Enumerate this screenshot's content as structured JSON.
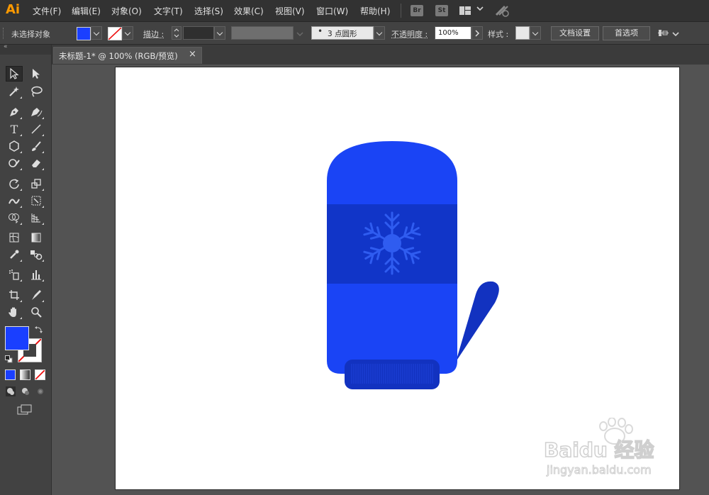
{
  "app": {
    "logo": "Ai"
  },
  "menu": [
    "文件(F)",
    "编辑(E)",
    "对象(O)",
    "文字(T)",
    "选择(S)",
    "效果(C)",
    "视图(V)",
    "窗口(W)",
    "帮助(H)"
  ],
  "app_buttons": {
    "bridge": "Br",
    "stock": "St"
  },
  "control": {
    "selection_status": "未选择对象",
    "stroke_label": "描边 :",
    "brush_value": "3 点圆形",
    "opacity_label": "不透明度 :",
    "opacity_value": "100%",
    "style_label": "样式 :",
    "doc_setup_button": "文档设置",
    "preferences_button": "首选项"
  },
  "document": {
    "tab_title": "未标题-1* @ 100% (RGB/预览)",
    "close_glyph": "×"
  },
  "colors": {
    "fill": "#1a3fff",
    "mitten_main": "#1a44f5",
    "mitten_band": "#1135c8",
    "cuff": "#1232c0",
    "snowflake": "#2f5cf0",
    "stroke": "none"
  },
  "tools": [
    "selection-tool",
    "direct-selection-tool",
    "magic-wand-tool",
    "lasso-tool",
    "pen-tool",
    "curvature-tool",
    "type-tool",
    "line-tool",
    "shape-tool",
    "paintbrush-tool",
    "shaper-tool",
    "eraser-tool",
    "rotate-tool",
    "scale-tool",
    "warp-tool",
    "free-transform-tool",
    "shape-builder-tool",
    "perspective-grid-tool",
    "mesh-tool",
    "gradient-tool",
    "eyedropper-tool",
    "blend-tool",
    "symbol-sprayer-tool",
    "graph-tool",
    "artboard-tool",
    "slice-tool",
    "hand-tool",
    "zoom-tool"
  ],
  "watermark": {
    "brand": "Baidu 经验",
    "url": "jingyan.baidu.com"
  }
}
